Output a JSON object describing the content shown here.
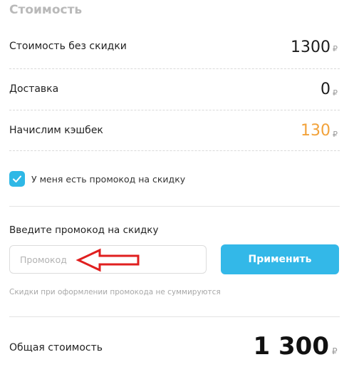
{
  "section_title": "Стоимость",
  "rows": [
    {
      "label": "Стоимость без скидки",
      "value": "1300",
      "currency": "₽"
    },
    {
      "label": "Доставка",
      "value": "0",
      "currency": "₽"
    },
    {
      "label": "Начислим кэшбек",
      "value": "130",
      "currency": "₽",
      "color": "#f2a23a"
    }
  ],
  "promo_checkbox": {
    "label": "У меня есть промокод на скидку",
    "checked": true,
    "color": "#2fb8e6"
  },
  "promo": {
    "title": "Введите промокод на скидку",
    "placeholder": "Промокод",
    "apply_label": "Применить",
    "note": "Скидки при оформлении промокода не суммируются",
    "arrow_icon": "arrow-left-icon",
    "arrow_color": "#e01f1f"
  },
  "total": {
    "label": "Общая стоимость",
    "value": "1 300",
    "currency": "₽"
  },
  "colors": {
    "accent": "#33b8e8",
    "cashback": "#f2a23a"
  }
}
